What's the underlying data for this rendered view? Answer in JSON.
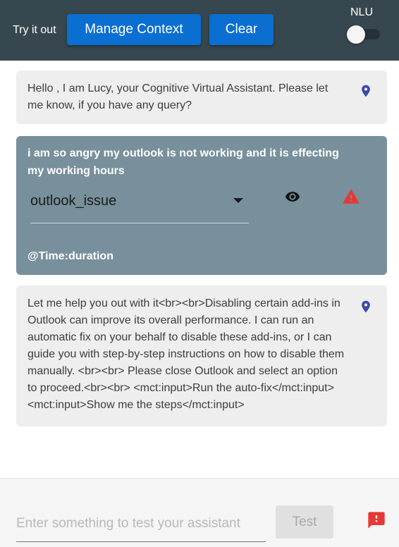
{
  "header": {
    "try_label": "Try it out",
    "manage_context_label": "Manage Context",
    "clear_label": "Clear",
    "nlu_label": "NLU",
    "nlu_enabled": false
  },
  "messages": {
    "greeting": {
      "text": "Hello , I am Lucy, your Cognitive Virtual Assistant. Please let me know, if you have any query?",
      "icon": "location-pin-icon"
    },
    "user": {
      "text": "i am so angry my outlook is not working and it is effecting my working hours",
      "intent": "outlook_issue",
      "entity": "@Time:duration"
    },
    "response": {
      "text": "Let me help you out with it<br><br>Disabling certain add-ins in Outlook can improve its overall performance. I can run an automatic fix on your behalf to disable these add-ins, or I can guide you with step-by-step instructions on how to disable them manually. <br><br> Please close Outlook and select an option to proceed.<br><br> <mct:input>Run the auto-fix</mct:input><mct:input>Show me the steps</mct:input>",
      "icon": "location-pin-icon"
    }
  },
  "footer": {
    "input_placeholder": "Enter something to test your assistant",
    "input_value": "",
    "test_label": "Test"
  },
  "colors": {
    "header_bg": "#37474f",
    "button_blue": "#0a6fd1",
    "user_bubble": "#78909c",
    "bot_bubble": "#eeeeee",
    "pin_blue": "#3b4aa6",
    "warning_red": "#e53935"
  }
}
